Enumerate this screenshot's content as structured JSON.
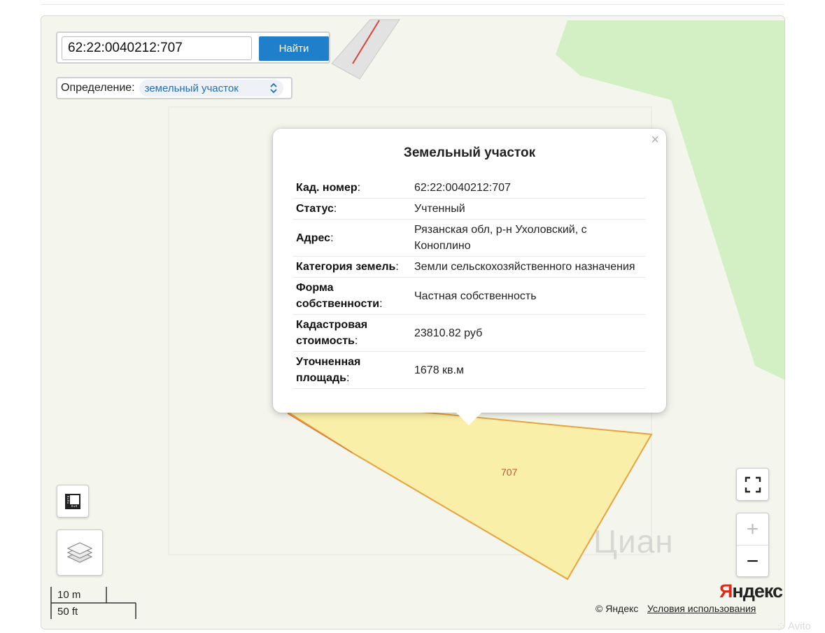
{
  "search": {
    "value": "62:22:0040212:707",
    "button_label": "Найти"
  },
  "definition": {
    "label": "Определение:",
    "selected": "земельный участок"
  },
  "popup": {
    "title": "Земельный участок",
    "close_glyph": "×",
    "rows": [
      {
        "key": "Кад. номер",
        "value": "62:22:0040212:707"
      },
      {
        "key": "Статус",
        "value": "Учтенный"
      },
      {
        "key": "Адрес",
        "value": "Рязанская обл, р-н Ухоловский, с Коноплино"
      },
      {
        "key": "Категория земель",
        "value": "Земли сельскохозяйственного назначения"
      },
      {
        "key": "Форма собственности",
        "value": "Частная собственность"
      },
      {
        "key": "Кадастровая стоимость",
        "value": "23810.82 руб"
      },
      {
        "key": "Уточненная площадь",
        "value": "1678 кв.м"
      }
    ]
  },
  "map": {
    "parcel_label": "707",
    "watermark": "Циан",
    "colors": {
      "parcel_fill": "#f9efa8",
      "parcel_stroke": "#e7a33d",
      "forest": "#d3f0c5",
      "background": "#f4f6ee"
    }
  },
  "controls": {
    "ruler_icon": "ruler-icon",
    "layers_icon": "layers-icon",
    "fullscreen_icon": "fullscreen-icon",
    "zoom_in": "+",
    "zoom_out": "−"
  },
  "scale": {
    "metric": "10 m",
    "imperial": "50 ft"
  },
  "attribution": {
    "logo_first": "Я",
    "logo_rest": "ндекс",
    "copyright": "© Яндекс",
    "terms": "Условия использования"
  },
  "avito": "Avito"
}
